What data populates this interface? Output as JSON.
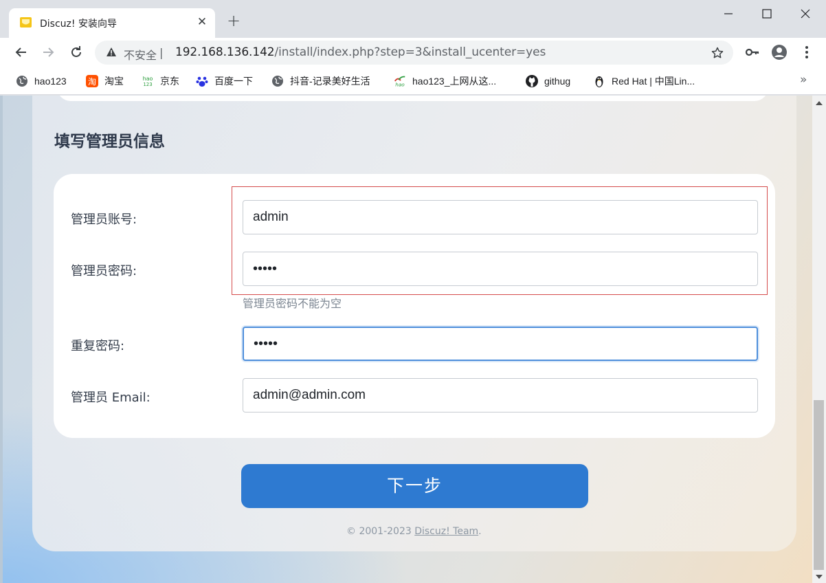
{
  "browser": {
    "tab": {
      "title": "Discuz! 安装向导"
    },
    "omnibox": {
      "security_label": "不安全",
      "separator": "|",
      "url_host": "192.168.136.142",
      "url_path": "/install/index.php?step=3&install_ucenter=yes"
    },
    "bookmarks": [
      {
        "label": "hao123",
        "icon": "globe-icon"
      },
      {
        "label": "淘宝",
        "icon": "taobao-icon"
      },
      {
        "label": "京东",
        "icon": "hao123-icon"
      },
      {
        "label": "百度一下",
        "icon": "baidu-paw-icon"
      },
      {
        "label": "抖音-记录美好生活",
        "icon": "globe-icon"
      },
      {
        "label": "hao123_上网从这...",
        "icon": "hao123-icon"
      },
      {
        "label": "githug",
        "icon": "github-icon"
      },
      {
        "label": "Red Hat | 中国Lin...",
        "icon": "penguin-icon"
      }
    ],
    "more_label": "»"
  },
  "page": {
    "section_title": "填写管理员信息",
    "fields": {
      "admin_account": {
        "label": "管理员账号:",
        "value": "admin"
      },
      "admin_password": {
        "label": "管理员密码:",
        "value": "•••••"
      },
      "password_hint": "管理员密码不能为空",
      "repeat_password": {
        "label": "重复密码:",
        "value": "•••••"
      },
      "admin_email": {
        "label": "管理员 Email:",
        "value": "admin@admin.com"
      }
    },
    "next_button": "下一步",
    "footer": {
      "copyright": "© 2001-2023 ",
      "link": "Discuz! Team",
      "suffix": "."
    }
  },
  "colors": {
    "accent": "#2e7ad1",
    "highlight_border": "#d44a4a",
    "focus_border": "#4d8edb"
  }
}
